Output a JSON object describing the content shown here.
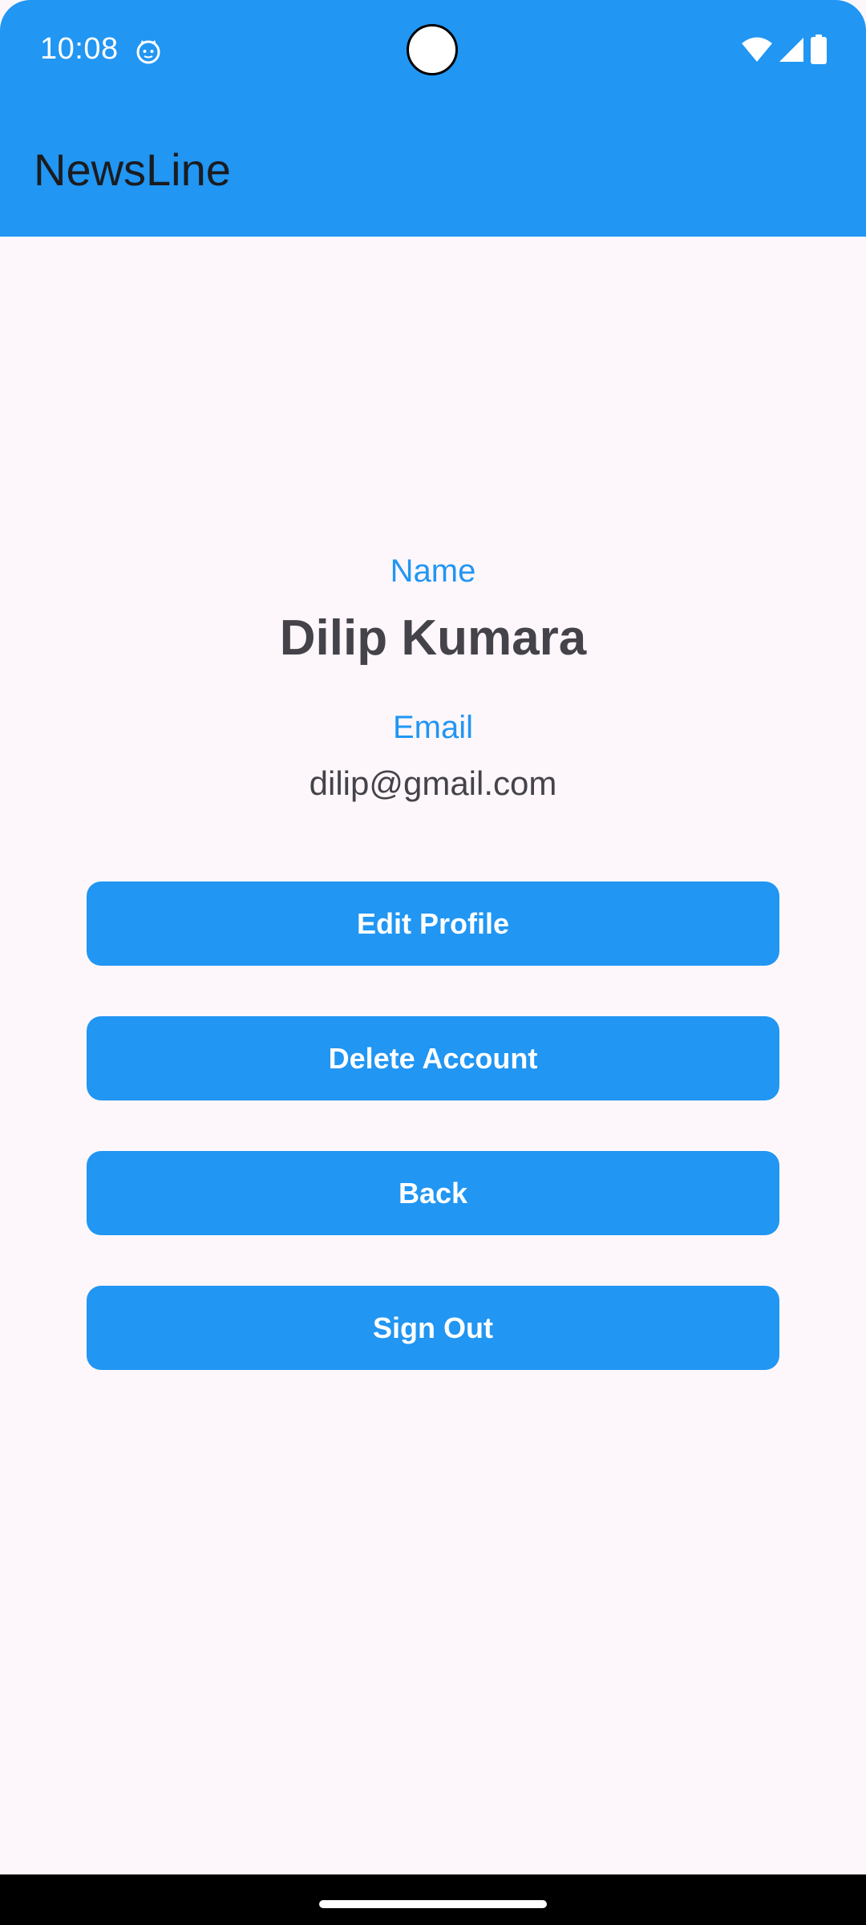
{
  "status_bar": {
    "time": "10:08",
    "app_icon": "android-cat-icon",
    "icons": [
      "wifi-icon",
      "cellular-signal-icon",
      "battery-icon"
    ]
  },
  "app_bar": {
    "title": "NewsLine"
  },
  "profile": {
    "name_label": "Name",
    "name_value": "Dilip Kumara",
    "email_label": "Email",
    "email_value": "dilip@gmail.com"
  },
  "actions": {
    "edit_profile": "Edit Profile",
    "delete_account": "Delete Account",
    "back": "Back",
    "sign_out": "Sign Out"
  },
  "colors": {
    "primary": "#2196f3",
    "background": "#fdf7fb",
    "text_dark": "#45434a",
    "title_text": "#1b1b1f"
  }
}
